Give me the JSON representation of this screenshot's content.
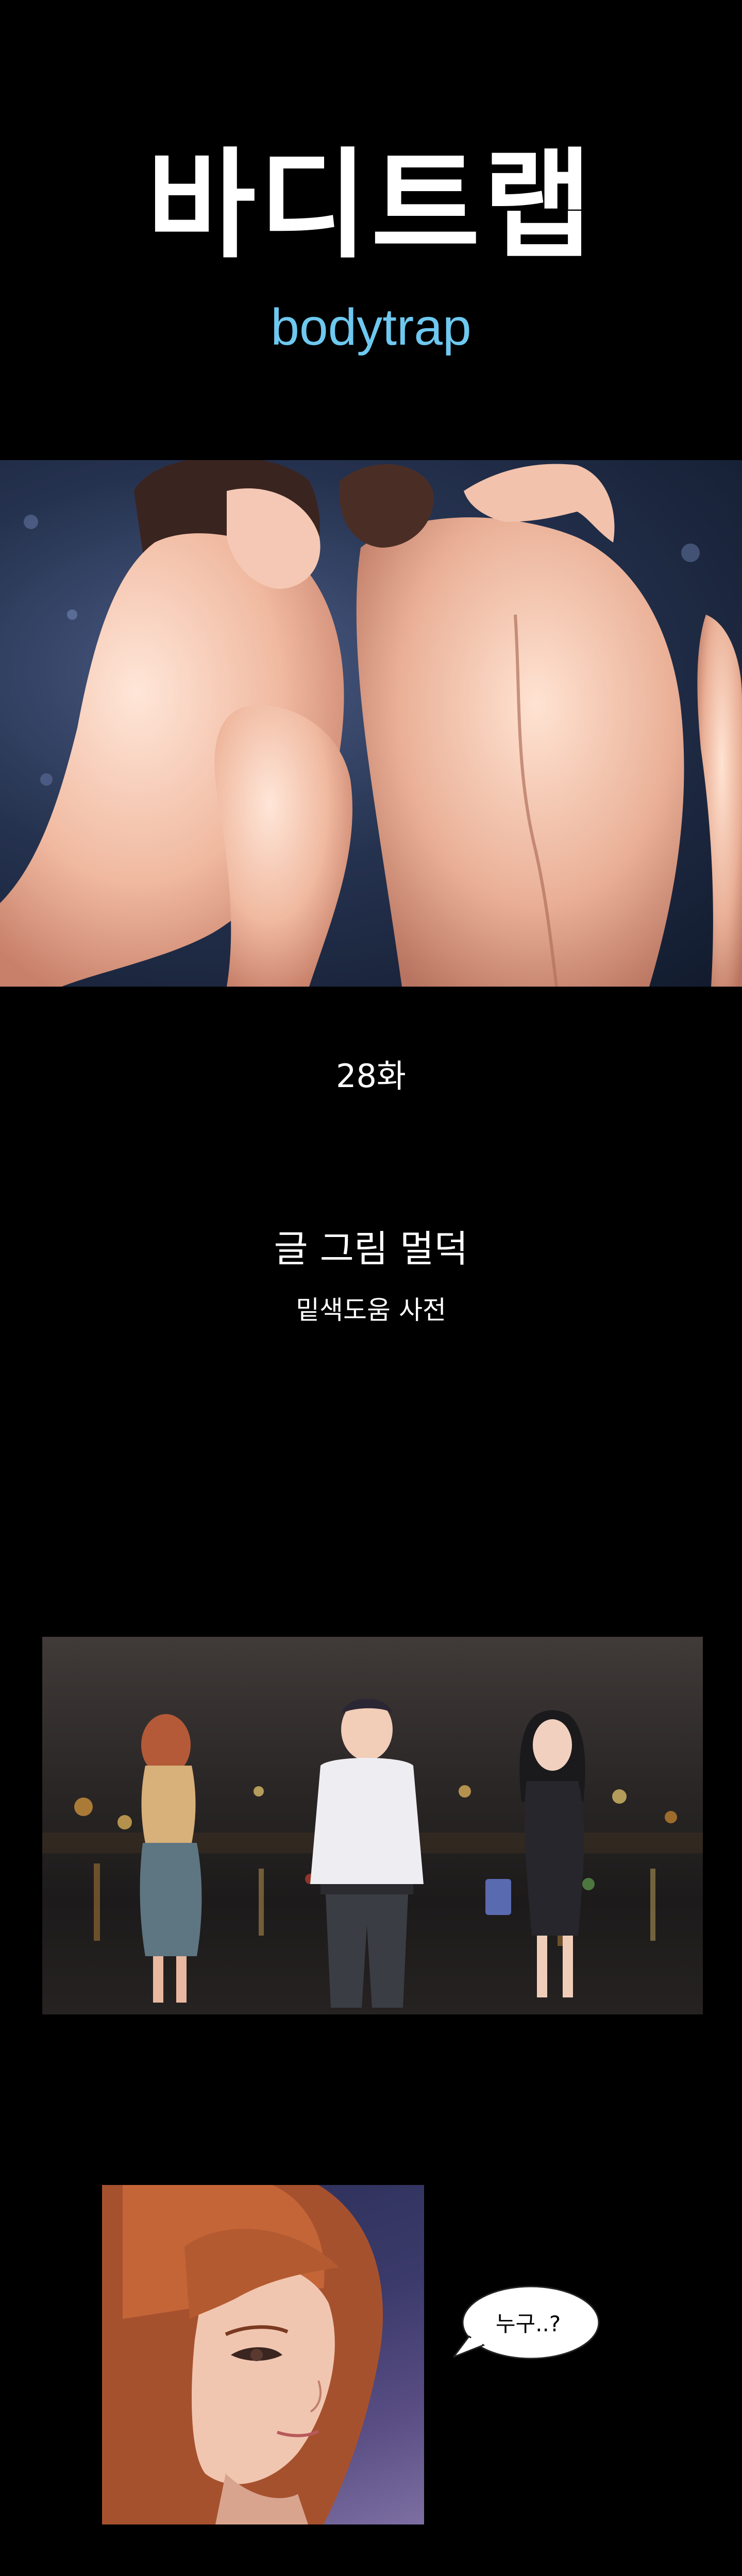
{
  "header": {
    "title": "바디트랩",
    "subtitle": "bodytrap"
  },
  "episode": {
    "label": "28화"
  },
  "credits": {
    "line1": "글 그림 멀덕",
    "line2": "밑색도움 사전"
  },
  "panels": {
    "panel3": {
      "speech": "누구..?"
    }
  },
  "colors": {
    "background": "#000000",
    "subtitle": "#6ec8f0",
    "text": "#ffffff"
  }
}
